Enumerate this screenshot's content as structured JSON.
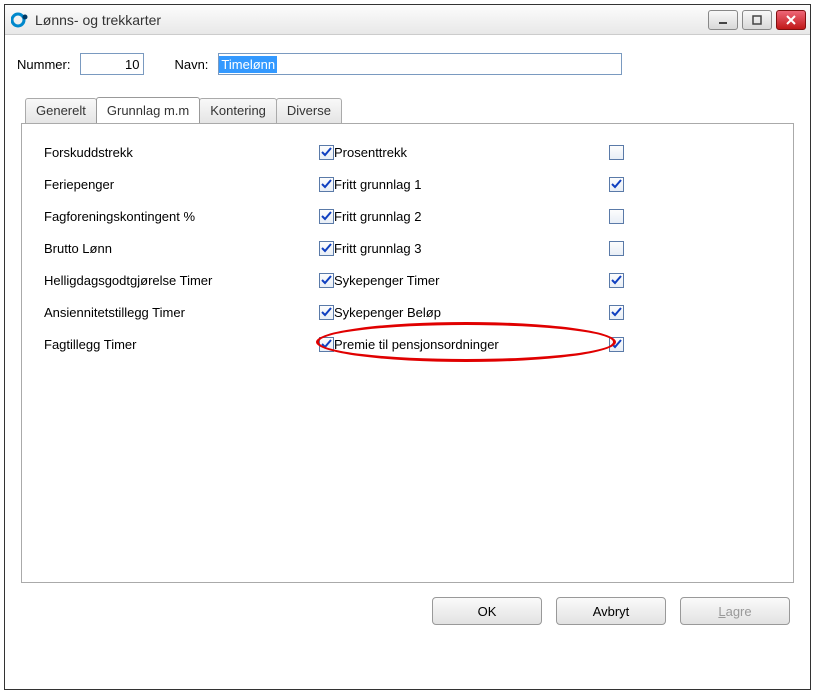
{
  "window": {
    "title": "Lønns- og trekkarter"
  },
  "header": {
    "nummer_label": "Nummer:",
    "nummer_value": "10",
    "navn_label": "Navn:",
    "navn_value": "Timelønn"
  },
  "tabs": {
    "generelt": "Generelt",
    "grunnlag": "Grunnlag m.m",
    "kontering": "Kontering",
    "diverse": "Diverse"
  },
  "left_items": [
    {
      "label": "Forskuddstrekk",
      "checked": true
    },
    {
      "label": "Feriepenger",
      "checked": true
    },
    {
      "label": "Fagforeningskontingent %",
      "checked": true
    },
    {
      "label": "Brutto Lønn",
      "checked": true
    },
    {
      "label": "Helligdagsgodtgjørelse Timer",
      "checked": true
    },
    {
      "label": "Ansiennitetstillegg Timer",
      "checked": true
    },
    {
      "label": "Fagtillegg Timer",
      "checked": true
    }
  ],
  "right_items": [
    {
      "label": "Prosenttrekk",
      "checked": false
    },
    {
      "label": "Fritt grunnlag 1",
      "checked": true
    },
    {
      "label": "Fritt grunnlag 2",
      "checked": false
    },
    {
      "label": "Fritt grunnlag 3",
      "checked": false
    },
    {
      "label": "Sykepenger Timer",
      "checked": true
    },
    {
      "label": "Sykepenger Beløp",
      "checked": true
    },
    {
      "label": "Premie til pensjonsordninger",
      "checked": true
    }
  ],
  "buttons": {
    "ok": "OK",
    "avbryt": "Avbryt",
    "lagre_pre": "L",
    "lagre_post": "agre"
  }
}
